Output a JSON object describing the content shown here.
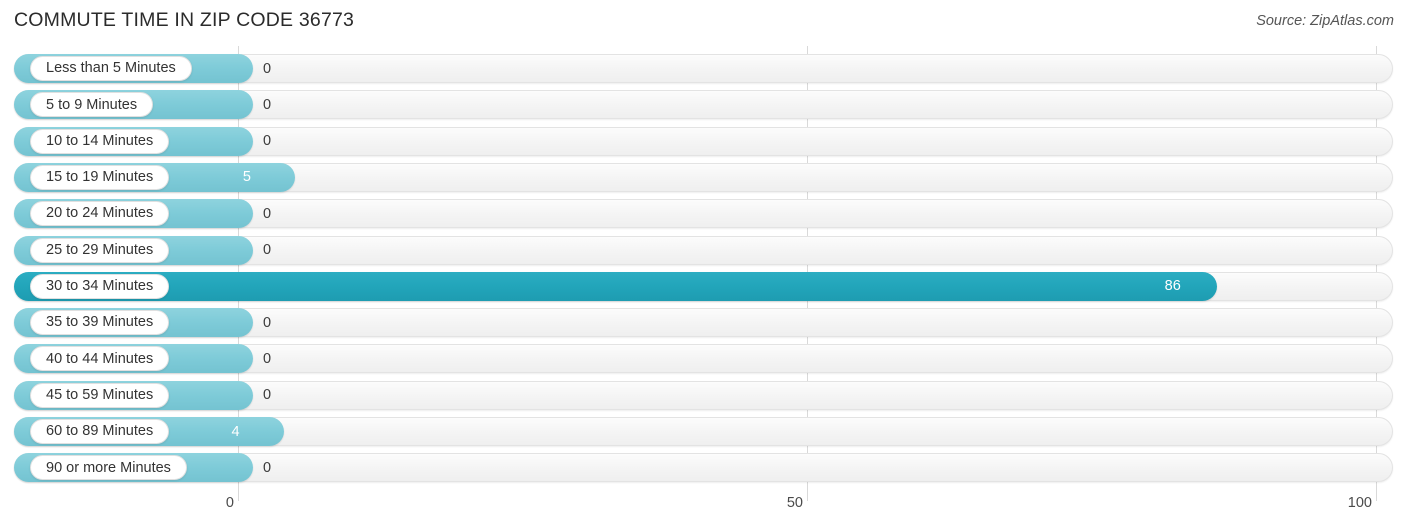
{
  "header": {
    "title": "COMMUTE TIME IN ZIP CODE 36773",
    "source": "Source: ZipAtlas.com"
  },
  "chart_data": {
    "type": "bar",
    "orientation": "horizontal",
    "title": "COMMUTE TIME IN ZIP CODE 36773",
    "subtitle": "",
    "xlabel": "",
    "ylabel": "",
    "xlim": [
      0,
      100
    ],
    "xticks": [
      0,
      50,
      100
    ],
    "xtick_labels": [
      "0",
      "50",
      "100"
    ],
    "grid": true,
    "legend": null,
    "categories": [
      "Less than 5 Minutes",
      "5 to 9 Minutes",
      "10 to 14 Minutes",
      "15 to 19 Minutes",
      "20 to 24 Minutes",
      "25 to 29 Minutes",
      "30 to 34 Minutes",
      "35 to 39 Minutes",
      "40 to 44 Minutes",
      "45 to 59 Minutes",
      "60 to 89 Minutes",
      "90 or more Minutes"
    ],
    "values": [
      0,
      0,
      0,
      5,
      0,
      0,
      86,
      0,
      0,
      0,
      4,
      0
    ],
    "value_labels": [
      "0",
      "0",
      "0",
      "5",
      "0",
      "0",
      "86",
      "0",
      "0",
      "0",
      "4",
      "0"
    ],
    "highlight_index": 6,
    "colors": {
      "bar": "#7ecbd8",
      "bar_highlight": "#22a5ba",
      "track": "#f4f4f4",
      "gridline": "#d9d9d9",
      "value_text": "#3a3a3a",
      "value_text_highlight": "#ffffff",
      "title_text": "#2b2b2b"
    }
  }
}
